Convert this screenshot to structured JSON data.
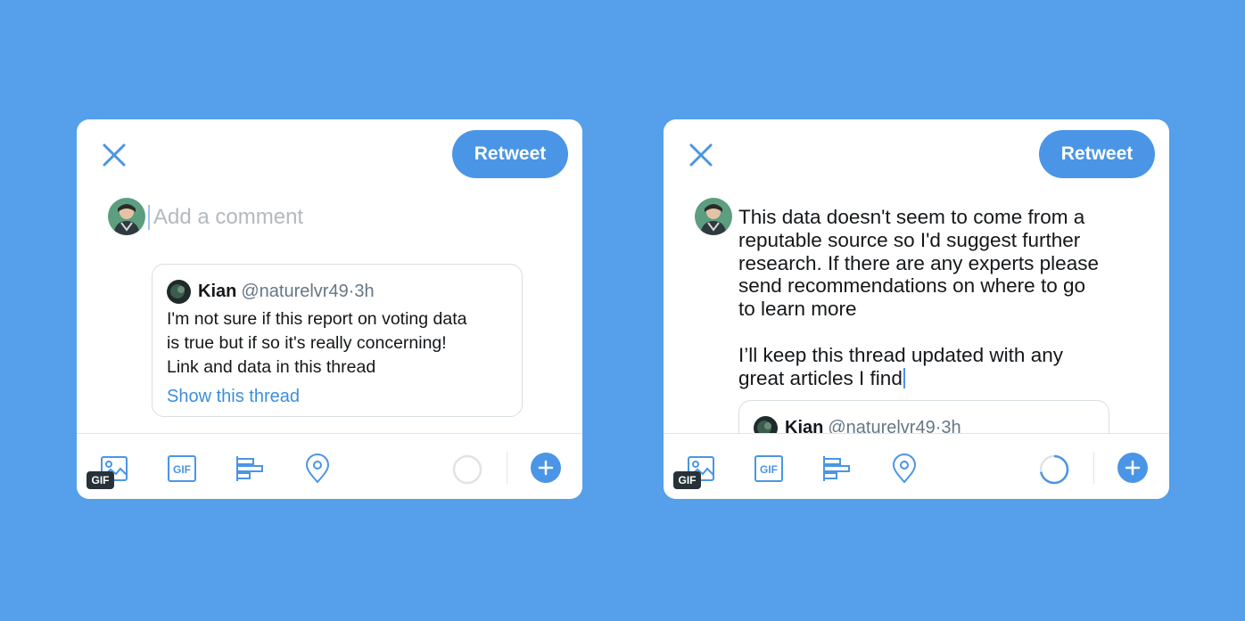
{
  "colors": {
    "background": "#569fea",
    "accent": "#4a95e6",
    "link": "#3b8fdc",
    "muted": "#657786",
    "placeholder": "#b4b9be"
  },
  "left_panel": {
    "retweet_label": "Retweet",
    "composer": {
      "placeholder": "Add a comment",
      "value": ""
    },
    "quoted_tweet": {
      "name": "Kian",
      "handle": "@naturelvr49",
      "separator": "·",
      "time": "3h",
      "text": "I'm not sure if this report on voting data\nis true but if so it's really concerning!\nLink and data in this thread",
      "link_label": "Show this thread"
    },
    "toolbar": {
      "gif_badge": "GIF",
      "icons": [
        "image-icon",
        "gif-icon",
        "poll-icon",
        "location-icon"
      ],
      "character_progress": 0
    }
  },
  "right_panel": {
    "retweet_label": "Retweet",
    "composer": {
      "paragraph_1": "This data doesn't seem to come from a\nreputable source so I'd suggest further\nresearch. If there are any experts please\nsend recommendations on where to go\nto learn more",
      "paragraph_2": "I’ll keep this thread updated with any\ngreat articles I find"
    },
    "quoted_tweet": {
      "name": "Kian",
      "handle": "@naturelvr49",
      "separator": "·",
      "time": "3h"
    },
    "toolbar": {
      "gif_badge": "GIF",
      "icons": [
        "image-icon",
        "gif-icon",
        "poll-icon",
        "location-icon"
      ],
      "character_progress": 0.72
    }
  }
}
